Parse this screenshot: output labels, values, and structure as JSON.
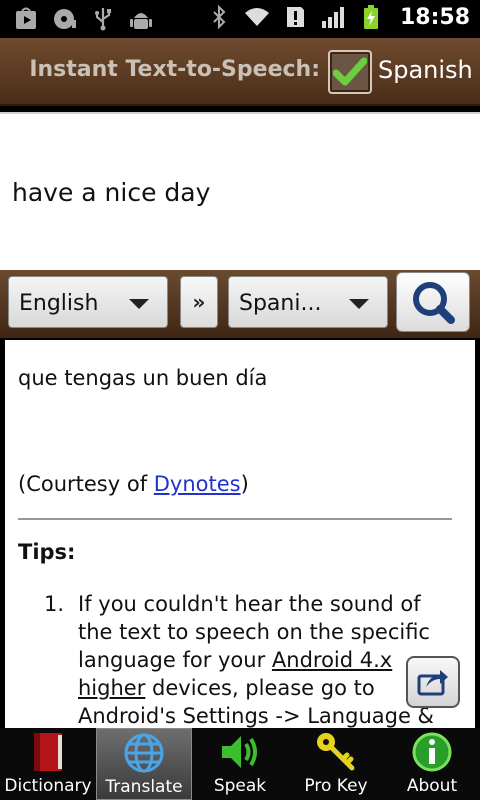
{
  "status_bar": {
    "time": "18:58",
    "left_icons": [
      "play-store-icon",
      "disc-icon",
      "usb-icon",
      "android-debug-icon"
    ],
    "right_icons": [
      "bluetooth-icon",
      "wifi-icon",
      "alert-icon",
      "signal-icon",
      "battery-charging-icon"
    ]
  },
  "header": {
    "title": "Instant Text-to-Speech:",
    "checkbox_checked": true,
    "language": "Spanish"
  },
  "input": {
    "text": "have a nice day"
  },
  "selector": {
    "from_language": "English",
    "swap_label": "»",
    "to_language": "Spani..."
  },
  "result": {
    "translation": "que tengas un buen día",
    "courtesy_prefix": "(Courtesy of ",
    "courtesy_link": "Dynotes",
    "courtesy_suffix": ")",
    "tips_heading": "Tips:",
    "tip_number": "1.",
    "tip_part1": "If you couldn't hear the sound of the text to speech on the specific language for your ",
    "tip_link": "Android 4.x higher",
    "tip_part2": " devices, please go to Android's Settings -> Language &"
  },
  "tabs": [
    {
      "label": "Dictionary",
      "icon": "book-icon",
      "active": false
    },
    {
      "label": "Translate",
      "icon": "globe-icon",
      "active": true
    },
    {
      "label": "Speak",
      "icon": "speaker-icon",
      "active": false
    },
    {
      "label": "Pro Key",
      "icon": "key-icon",
      "active": false
    },
    {
      "label": "About",
      "icon": "info-icon",
      "active": false
    }
  ],
  "colors": {
    "header_brown": "#5c3b22",
    "link_blue": "#2233cc",
    "speak_green": "#3bbf2e",
    "key_yellow": "#e6d21a"
  }
}
